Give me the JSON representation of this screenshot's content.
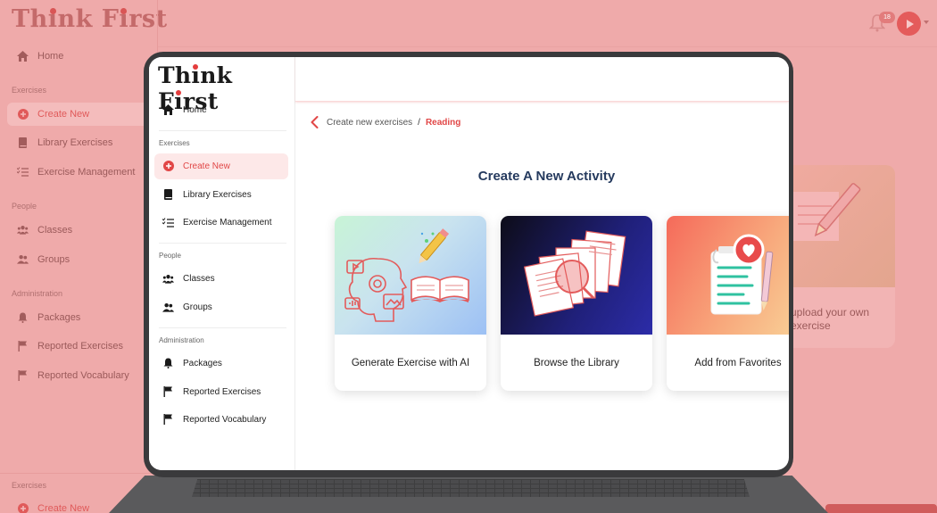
{
  "background_app": {
    "logo": "Think First",
    "nav": {
      "home": "Home",
      "section_exercises": "Exercises",
      "create_new": "Create New",
      "library_exercises": "Library Exercises",
      "exercise_management": "Exercise Management",
      "section_people": "People",
      "classes": "Classes",
      "groups": "Groups",
      "section_administration": "Administration",
      "packages": "Packages",
      "reported_exercises": "Reported Exercises",
      "reported_vocabulary": "Reported Vocabulary"
    },
    "bottom_section": "Exercises",
    "bottom_create_new": "Create New",
    "notification_count": "18",
    "side_card_text": "upload your own exercise"
  },
  "screen": {
    "logo": "Think First",
    "nav": {
      "home": "Home",
      "section_exercises": "Exercises",
      "create_new": "Create New",
      "library_exercises": "Library Exercises",
      "exercise_management": "Exercise Management",
      "section_people": "People",
      "classes": "Classes",
      "groups": "Groups",
      "section_administration": "Administration",
      "packages": "Packages",
      "reported_exercises": "Reported Exercises",
      "reported_vocabulary": "Reported Vocabulary"
    },
    "breadcrumb": {
      "parent": "Create new exercises",
      "separator": "/",
      "current": "Reading"
    },
    "page_title": "Create A New Activity",
    "cards": [
      {
        "label": "Generate Exercise with AI"
      },
      {
        "label": "Browse the Library"
      },
      {
        "label": "Add from Favorites"
      }
    ]
  },
  "colors": {
    "accent": "#e14747",
    "title": "#253a5e",
    "overlay": "#efaaaa",
    "laptop": "#3a3a3c"
  },
  "icons": {
    "home": "home-icon",
    "create_new": "plus-circle-icon",
    "library": "book-icon",
    "management": "list-check-icon",
    "classes": "users-icon",
    "groups": "user-group-icon",
    "packages": "bell-icon",
    "reported": "flag-icon",
    "back": "chevron-left-icon"
  }
}
